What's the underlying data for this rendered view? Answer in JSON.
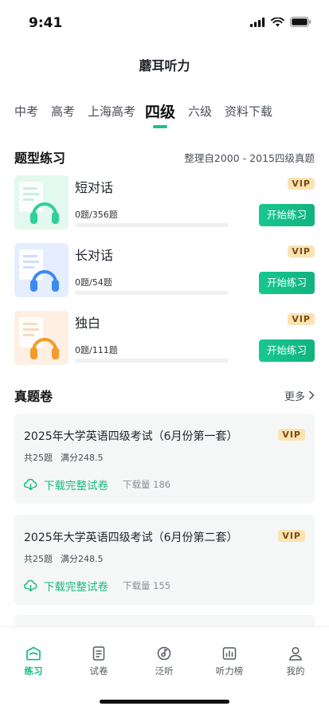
{
  "status_bar": {
    "time": "9:41"
  },
  "header": {
    "title": "蘑耳听力"
  },
  "tabs": [
    {
      "label": "中考"
    },
    {
      "label": "高考"
    },
    {
      "label": "上海高考"
    },
    {
      "label": "四级",
      "active": true
    },
    {
      "label": "六级"
    },
    {
      "label": "资料下载"
    }
  ],
  "practice_section": {
    "title": "题型练习",
    "subtitle": "整理自2000 - 2015四级真题",
    "items": [
      {
        "title": "短对话",
        "progress": "0题/356题",
        "progress_fraction": 0,
        "vip": "VIP",
        "button": "开始练习",
        "theme": "green"
      },
      {
        "title": "长对话",
        "progress": "0题/54题",
        "progress_fraction": 0,
        "vip": "VIP",
        "button": "开始练习",
        "theme": "blue"
      },
      {
        "title": "独白",
        "progress": "0题/111题",
        "progress_fraction": 0,
        "vip": "VIP",
        "button": "开始练习",
        "theme": "orange"
      }
    ]
  },
  "exam_section": {
    "title": "真题卷",
    "more": "更多",
    "items": [
      {
        "title": "2025年大学英语四级考试（6月份第一套）",
        "count": "共25题",
        "score": "满分248.5",
        "vip": "VIP",
        "download": "下载完整试卷",
        "downloads": "下载量 186"
      },
      {
        "title": "2025年大学英语四级考试（6月份第二套）",
        "count": "共25题",
        "score": "满分248.5",
        "vip": "VIP",
        "download": "下载完整试卷",
        "downloads": "下载量 155"
      }
    ]
  },
  "tabbar": {
    "items": [
      {
        "label": "练习",
        "icon": "practice-icon",
        "active": true
      },
      {
        "label": "试卷",
        "icon": "paper-icon"
      },
      {
        "label": "泛听",
        "icon": "music-disc-icon"
      },
      {
        "label": "听力榜",
        "icon": "chart-icon"
      },
      {
        "label": "我的",
        "icon": "profile-icon"
      }
    ]
  },
  "colors": {
    "accent": "#19c18a",
    "vip_bg": "#fbe3b4",
    "vip_text": "#7a4a12",
    "card_bg": "#f4f7f6"
  }
}
